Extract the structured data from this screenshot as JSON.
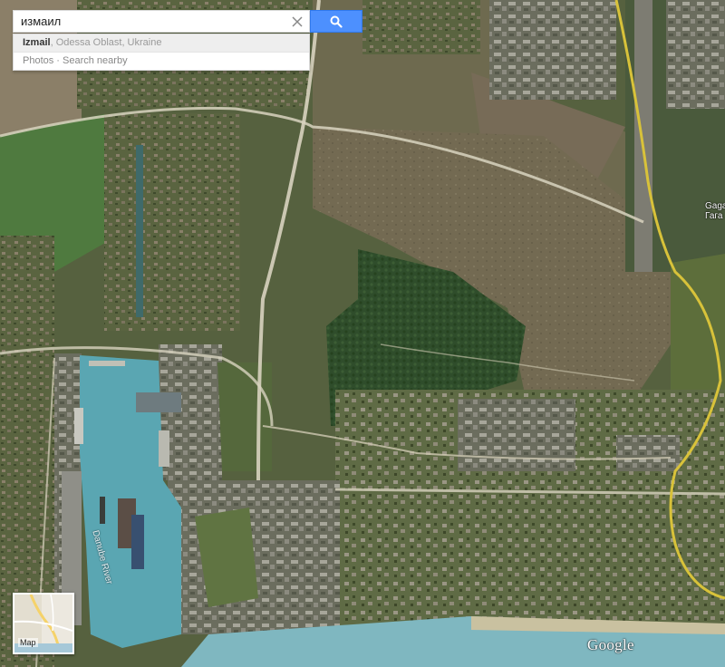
{
  "search": {
    "query": "измаил",
    "button_icon": "search-icon",
    "clear_icon": "close-icon"
  },
  "suggestions": {
    "primary_name": "Izmail",
    "primary_detail": ", Odessa Oblast, Ukraine",
    "actions": "Photos · Search nearby"
  },
  "minimap": {
    "label": "Map"
  },
  "map_labels": {
    "river": "Danube River",
    "gagarin": "Gaga",
    "gagarin_cyr": "Гага"
  },
  "branding": {
    "logo": "Google"
  },
  "colors": {
    "search_button": "#4d90fe",
    "road": "#d8d3bf",
    "water": "#5aa6b2",
    "river": "#7fb7c0",
    "yellow_road": "#d8c23a"
  }
}
